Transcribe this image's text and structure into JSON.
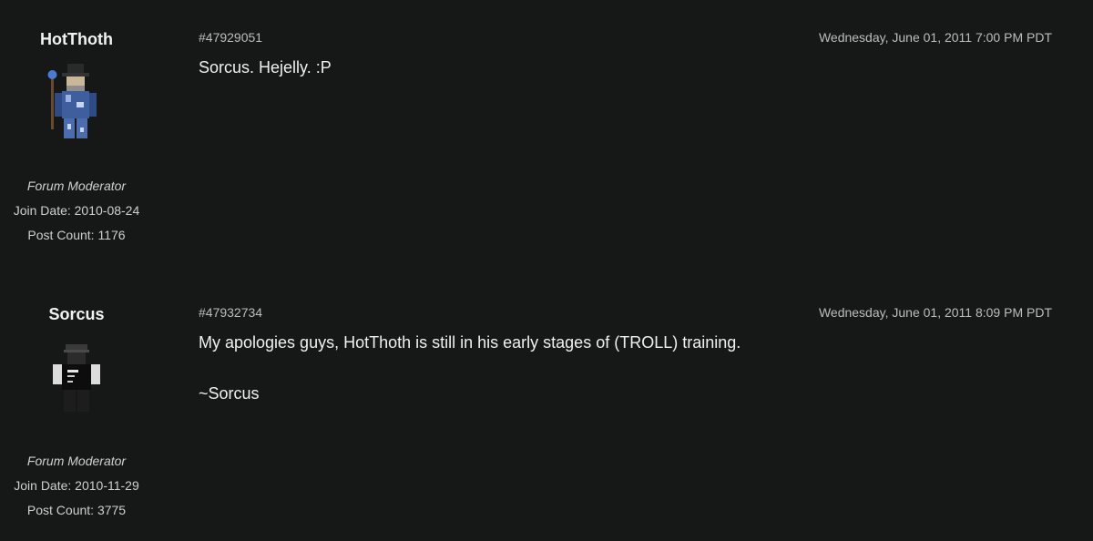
{
  "posts": [
    {
      "author": {
        "username": "HotThoth",
        "role": "Forum Moderator",
        "join_date": "Join Date: 2010-08-24",
        "post_count": "Post Count: 1176",
        "avatar_icon": "robed-wizard-avatar-icon"
      },
      "post_id": "#47929051",
      "timestamp": "Wednesday, June 01, 2011 7:00 PM PDT",
      "body": [
        "Sorcus. Hejelly. :P"
      ]
    },
    {
      "author": {
        "username": "Sorcus",
        "role": "Forum Moderator",
        "join_date": "Join Date: 2010-11-29",
        "post_count": "Post Count: 3775",
        "avatar_icon": "black-shirt-avatar-icon"
      },
      "post_id": "#47932734",
      "timestamp": "Wednesday, June 01, 2011 8:09 PM PDT",
      "body": [
        "My apologies guys, HotThoth is still in his early stages of (TROLL) training.",
        "",
        "~Sorcus"
      ]
    }
  ],
  "colors": {
    "background": "#161717",
    "text": "#f0f0f0",
    "muted": "#bdbdbd"
  }
}
